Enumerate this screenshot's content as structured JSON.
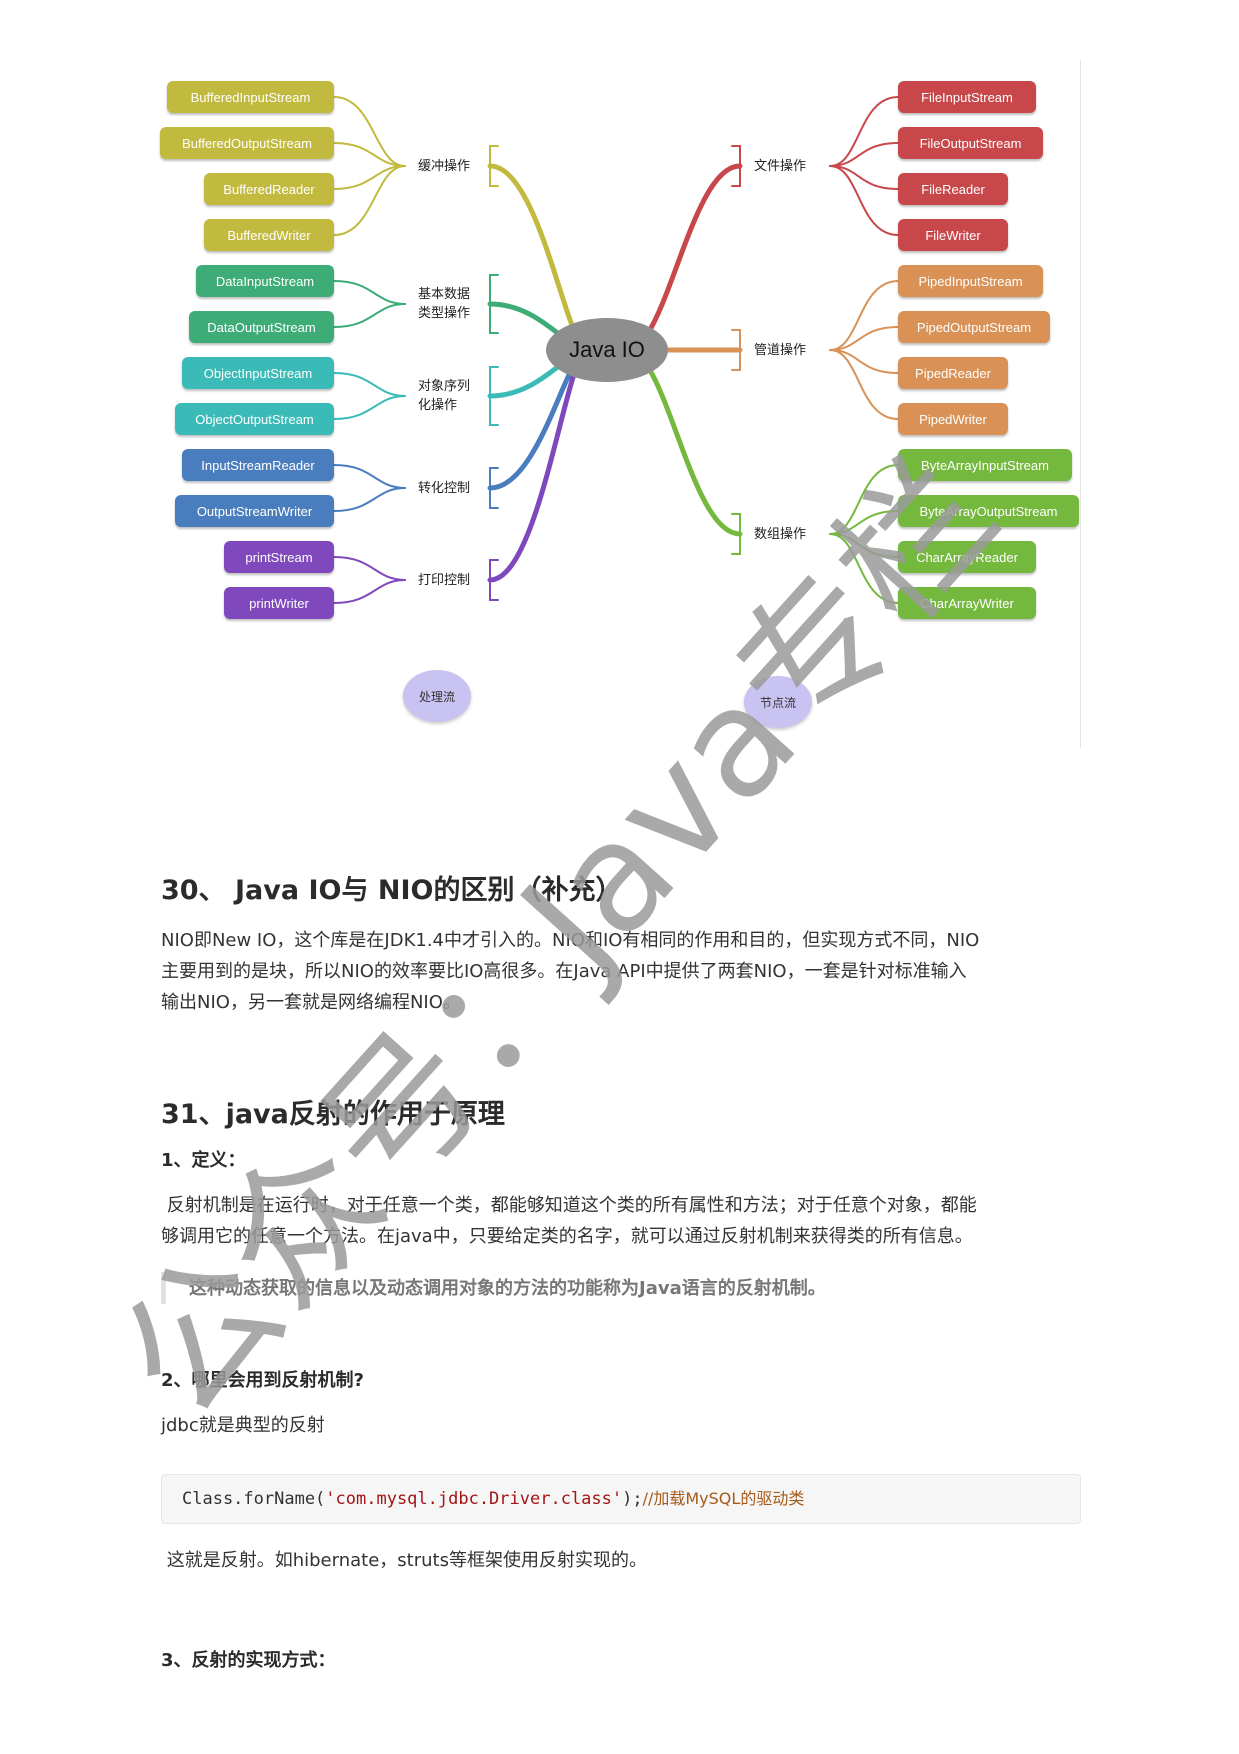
{
  "diagram": {
    "center": "Java IO",
    "left_branches": [
      {
        "label_lines": [
          "缓冲操作"
        ],
        "color": "#c2ba3f",
        "items": [
          "BufferedInputStream",
          "BufferedOutputStream",
          "BufferedReader",
          "BufferedWriter"
        ]
      },
      {
        "label_lines": [
          "基本数据",
          "类型操作"
        ],
        "color": "#3dac77",
        "items": [
          "DataInputStream",
          "DataOutputStream"
        ]
      },
      {
        "label_lines": [
          "对象序列",
          "化操作"
        ],
        "color": "#3bbbb8",
        "items": [
          "ObjectInputStream",
          "ObjectOutputStream"
        ]
      },
      {
        "label_lines": [
          "转化控制"
        ],
        "color": "#4a7dbd",
        "items": [
          "InputStreamReader",
          "OutputStreamWriter"
        ]
      },
      {
        "label_lines": [
          "打印控制"
        ],
        "color": "#7f49bd",
        "items": [
          "printStream",
          "printWriter"
        ]
      }
    ],
    "right_branches": [
      {
        "label_lines": [
          "文件操作"
        ],
        "color": "#c8474b",
        "items": [
          "FileInputStream",
          "FileOutputStream",
          "FileReader",
          "FileWriter"
        ]
      },
      {
        "label_lines": [
          "管道操作"
        ],
        "color": "#d99155",
        "items": [
          "PipedInputStream",
          "PipedOutputStream",
          "PipedReader",
          "PipedWriter"
        ]
      },
      {
        "label_lines": [
          "数组操作"
        ],
        "color": "#75b83e",
        "items": [
          "ByteArrayInputStream",
          "ByteArrayOutputStream",
          "CharArrayReader",
          "CharArrayWriter"
        ]
      }
    ],
    "bubble_left": "处理流",
    "bubble_right": "节点流"
  },
  "sec30": {
    "title": "30、 Java IO与 NIO的区别（补充）",
    "lines": [
      "NIO即New IO，这个库是在JDK1.4中才引入的。NIO和IO有相同的作用和目的，但实现方式不同，NIO",
      "主要用到的是块，所以NIO的效率要比IO高很多。在Java API中提供了两套NIO，一套是针对标准输入",
      "输出NIO，另一套就是网络编程NIO。"
    ]
  },
  "sec31": {
    "title": "31、java反射的作用于原理",
    "sub1": "1、定义：",
    "def_lines": [
      " 反射机制是在运行时，对于任意一个类，都能够知道这个类的所有属性和方法；对于任意个对象，都能",
      "够调用它的任意一个方法。在java中，只要给定类的名字，就可以通过反射机制来获得类的所有信息。"
    ],
    "quote": "这种动态获取的信息以及动态调用对象的方法的功能称为Java语言的反射机制。",
    "sub2": "2、哪里会用到反射机制?",
    "jdbc_line": "jdbc就是典型的反射",
    "code": {
      "prefix": "Class.forName(",
      "string": "'com.mysql.jdbc.Driver.class'",
      "suffix": ");",
      "comment": "//加载MySQL的驱动类"
    },
    "after_code": " 这就是反射。如hibernate，struts等框架使用反射实现的。",
    "sub3": "3、反射的实现方式："
  },
  "watermark": {
    "text": "公众号：Java专栏",
    "color": "#9a9a9a"
  }
}
